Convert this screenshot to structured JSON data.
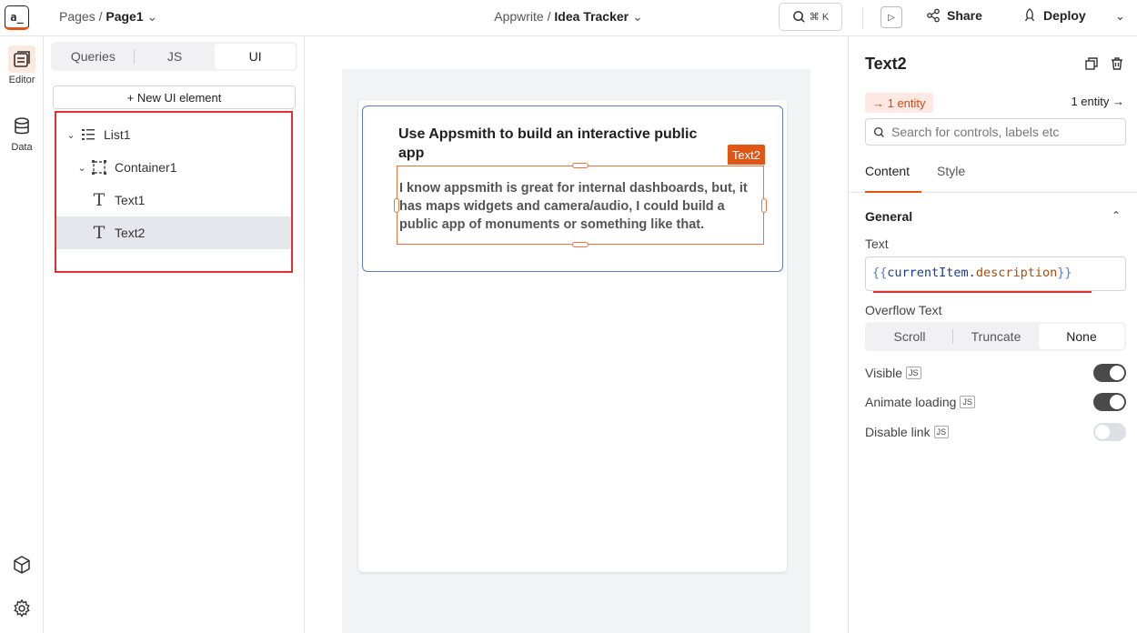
{
  "header": {
    "logo_text": "a_",
    "pages_label": "Pages /",
    "page_name": "Page1",
    "workspace": "Appwrite /",
    "app_name": "Idea Tracker",
    "search_shortcut": "⌘ K",
    "share_label": "Share",
    "deploy_label": "Deploy"
  },
  "rail": {
    "editor_label": "Editor",
    "data_label": "Data"
  },
  "explorer": {
    "tabs": [
      "Queries",
      "JS",
      "UI"
    ],
    "active_tab": "UI",
    "new_ui_label": "+ New UI element",
    "tree": [
      {
        "label": "List1",
        "type": "list",
        "expanded": true
      },
      {
        "label": "Container1",
        "type": "container",
        "expanded": true
      },
      {
        "label": "Text1",
        "type": "text"
      },
      {
        "label": "Text2",
        "type": "text",
        "selected": true
      }
    ]
  },
  "canvas": {
    "text1_value": "Use Appsmith to build an interactive public app",
    "text2_value": "I know appsmith is great for internal dashboards, but, it has maps widgets and camera/audio, I could build a public app of monuments or something like that.",
    "selected_tag": "Text2"
  },
  "pane": {
    "widget_name": "Text2",
    "entity_left": "→ 1 entity",
    "entity_right": "1 entity →",
    "search_placeholder": "Search for controls, labels etc",
    "tabs": [
      "Content",
      "Style"
    ],
    "active_tab": "Content",
    "section": "General",
    "text_label": "Text",
    "text_binding": {
      "open": "{{",
      "object": "currentItem",
      "dot": ".",
      "property": "description",
      "close": "}}"
    },
    "overflow_label": "Overflow Text",
    "overflow_options": [
      "Scroll",
      "Truncate",
      "None"
    ],
    "overflow_selected": "None",
    "toggles": [
      {
        "label": "Visible",
        "js": "JS",
        "on": true
      },
      {
        "label": "Animate loading",
        "js": "JS",
        "on": true
      },
      {
        "label": "Disable link",
        "js": "JS",
        "on": false
      }
    ]
  },
  "colors": {
    "accent": "#e15615",
    "selection_outline": "#e8743b",
    "container_border": "#5b7bd5",
    "highlight_red": "#e03131"
  }
}
